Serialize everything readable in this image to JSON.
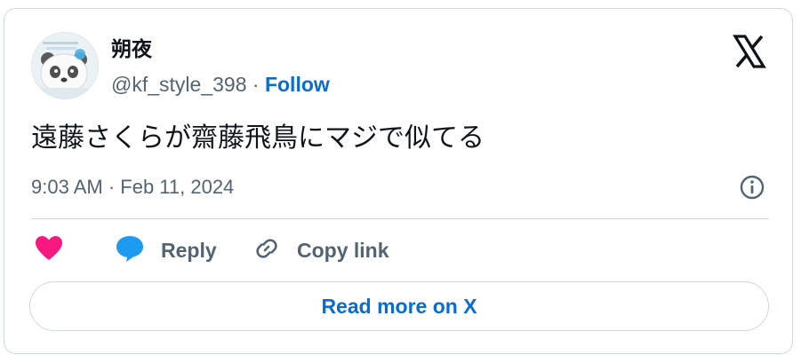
{
  "author": {
    "display_name": "朔夜",
    "handle": "@kf_style_398",
    "separator": "·",
    "follow_label": "Follow"
  },
  "tweet": {
    "text": "遠藤さくらが齋藤飛鳥にマジで似てる",
    "timestamp": "9:03 AM · Feb 11, 2024"
  },
  "actions": {
    "reply_label": "Reply",
    "copy_link_label": "Copy link"
  },
  "read_more_label": "Read more on X",
  "icons": [
    "avatar",
    "x-logo-icon",
    "info-icon",
    "heart-icon",
    "reply-bubble-icon",
    "link-icon"
  ],
  "colors": {
    "accent": "#0a6bd1",
    "heart": "#f91880",
    "reply_bubble": "#1d9bf0",
    "muted_text": "#536471",
    "border": "#cfd9de"
  }
}
